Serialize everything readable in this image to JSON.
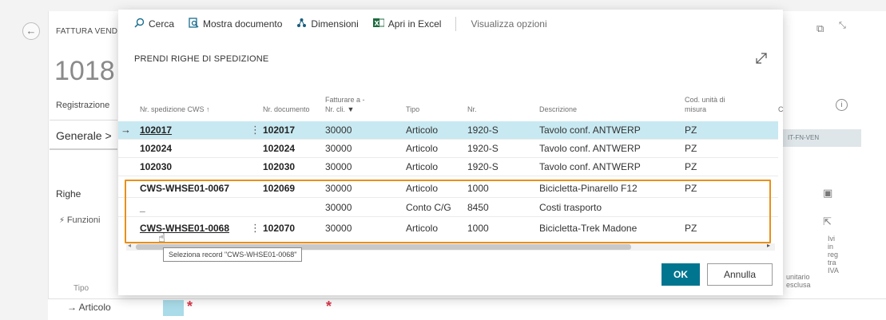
{
  "background": {
    "caption": "FATTURA VEND",
    "doc_number": "1018 ·",
    "registrazione": "Registrazione",
    "generale": "Generale >",
    "righe": "Righe",
    "funzioni": "Funzioni",
    "tipo": "Tipo",
    "articolo": "→ Articolo",
    "tag": "IT-FN-VEN",
    "col_unitario": "unitario\nesclusa",
    "col_iva": "Ivi\nin\nreg\ntra\nIVA"
  },
  "toolbar": {
    "search_label": "Cerca",
    "show_doc_label": "Mostra documento",
    "dimensions_label": "Dimensioni",
    "excel_label": "Apri in Excel",
    "options_label": "Visualizza opzioni"
  },
  "modal": {
    "title": "PRENDI RIGHE DI SPEDIZIONE"
  },
  "table": {
    "headers": {
      "shipment_no": "Nr. spedizione CWS ↑",
      "document_no": "Nr. documento",
      "bill_to_line1": "Fatturare a -",
      "bill_to_line2": "Nr. cli.",
      "type": "Tipo",
      "no": "Nr.",
      "description": "Descrizione",
      "uom_line1": "Cod. unità di",
      "uom_line2": "misura",
      "extra": "C"
    },
    "rows": [
      {
        "shipment": "102017",
        "doc": "102017",
        "customer": "30000",
        "type": "Articolo",
        "no": "1920-S",
        "desc": "Tavolo conf. ANTWERP",
        "uom": "PZ"
      },
      {
        "shipment": "102024",
        "doc": "102024",
        "customer": "30000",
        "type": "Articolo",
        "no": "1920-S",
        "desc": "Tavolo conf. ANTWERP",
        "uom": "PZ"
      },
      {
        "shipment": "102030",
        "doc": "102030",
        "customer": "30000",
        "type": "Articolo",
        "no": "1920-S",
        "desc": "Tavolo conf. ANTWERP",
        "uom": "PZ"
      },
      {
        "shipment": "CWS-WHSE01-0067",
        "doc": "102069",
        "customer": "30000",
        "type": "Articolo",
        "no": "1000",
        "desc": "Bicicletta-Pinarello F12",
        "uom": "PZ"
      },
      {
        "shipment": "_",
        "doc": "",
        "customer": "30000",
        "type": "Conto C/G",
        "no": "8450",
        "desc": "Costi trasporto",
        "uom": ""
      },
      {
        "shipment": "CWS-WHSE01-0068",
        "doc": "102070",
        "customer": "30000",
        "type": "Articolo",
        "no": "1000",
        "desc": "Bicicletta-Trek Madone",
        "uom": "PZ"
      }
    ]
  },
  "tooltip": "Seleziona record \"CWS-WHSE01-0068\"",
  "buttons": {
    "ok": "OK",
    "cancel": "Annulla"
  },
  "colors": {
    "accent": "#00758f",
    "selected_row": "#c8e9f1",
    "highlight": "#e8901a"
  }
}
